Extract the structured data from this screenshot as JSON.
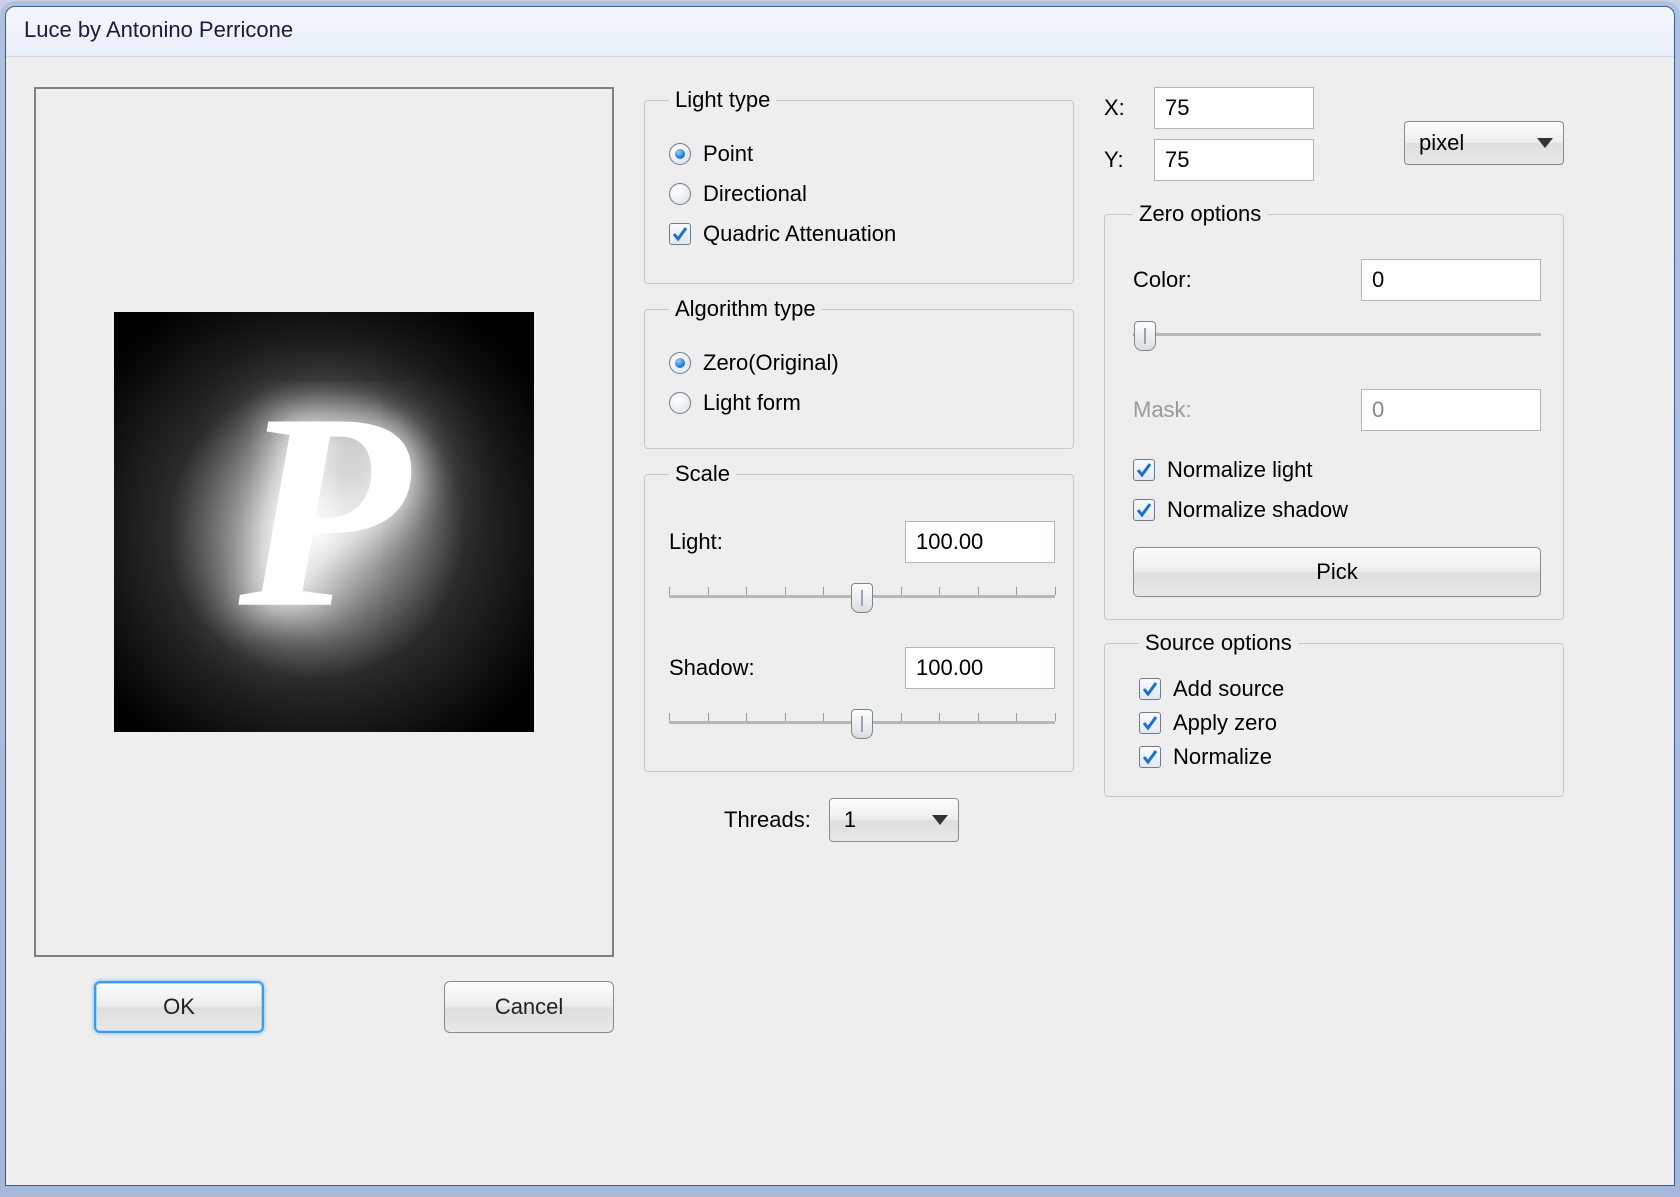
{
  "window": {
    "title": "Luce by Antonino Perricone"
  },
  "buttons": {
    "ok": "OK",
    "cancel": "Cancel",
    "pick": "Pick"
  },
  "light_type": {
    "legend": "Light type",
    "point": "Point",
    "directional": "Directional",
    "quadric": "Quadric Attenuation",
    "selected": "point",
    "quadric_on": true
  },
  "algorithm": {
    "legend": "Algorithm type",
    "zero": "Zero(Original)",
    "lightform": "Light form",
    "selected": "zero"
  },
  "scale": {
    "legend": "Scale",
    "light_label": "Light:",
    "light_value": "100.00",
    "shadow_label": "Shadow:",
    "shadow_value": "100.00"
  },
  "threads": {
    "label": "Threads:",
    "value": "1"
  },
  "position": {
    "x_label": "X:",
    "x_value": "75",
    "y_label": "Y:",
    "y_value": "75",
    "unit": "pixel"
  },
  "zero": {
    "legend": "Zero options",
    "color_label": "Color:",
    "color_value": "0",
    "mask_label": "Mask:",
    "mask_value": "0",
    "norm_light": "Normalize light",
    "norm_light_on": true,
    "norm_shadow": "Normalize shadow",
    "norm_shadow_on": true
  },
  "source": {
    "legend": "Source options",
    "add": "Add source",
    "add_on": true,
    "apply": "Apply zero",
    "apply_on": true,
    "normalize": "Normalize",
    "normalize_on": true
  },
  "preview_letter": "P"
}
